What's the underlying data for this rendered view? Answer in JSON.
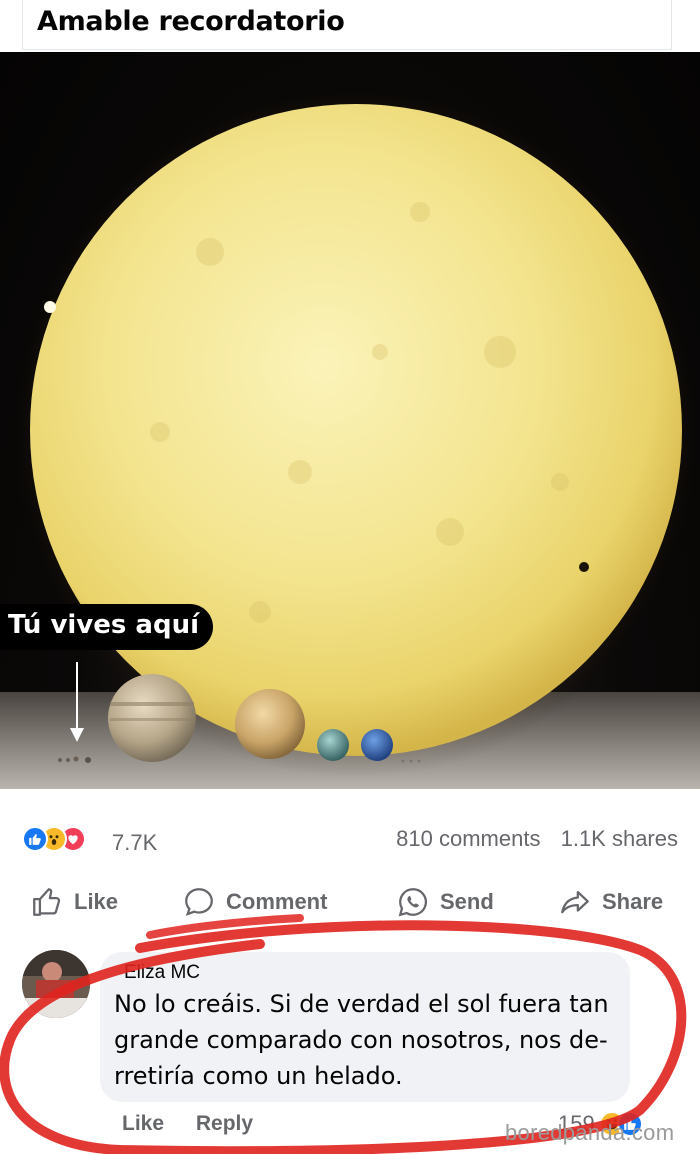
{
  "post": {
    "title": "Amable recordatorio",
    "image_caption": "Tú vives aquí"
  },
  "stats": {
    "reaction_icons": [
      "like-icon",
      "wow-icon",
      "love-icon"
    ],
    "reaction_count": "7.7K",
    "comments": "810 comments",
    "shares": "1.1K shares"
  },
  "actions": {
    "like": "Like",
    "comment": "Comment",
    "send": "Send",
    "share": "Share"
  },
  "comment": {
    "author": "Eliza MC",
    "text": "No lo creáis. Si de verdad el sol fuera tan grande comparado con nosotros, nos de-rretiría como un helado.",
    "like_label": "Like",
    "reply_label": "Reply",
    "reaction_count": "159",
    "reaction_icons": [
      "haha-icon",
      "like-icon"
    ]
  },
  "watermark": "boredpanda.com",
  "colors": {
    "facebook_blue": "#1877f2",
    "sun_yellow": "#f3e89a",
    "highlight_red": "#e0231e"
  }
}
